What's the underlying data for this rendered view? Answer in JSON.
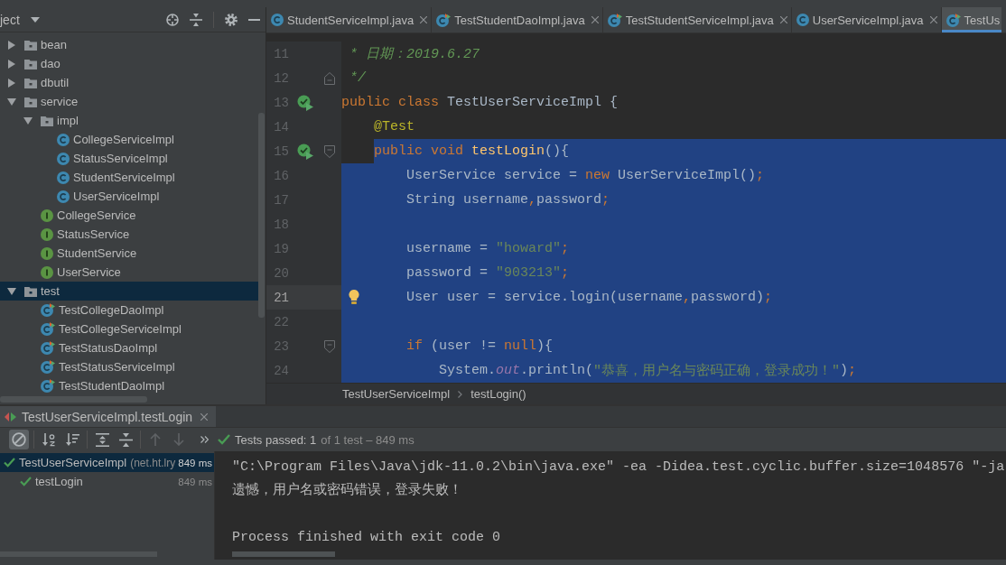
{
  "project_panel": {
    "view_label": "ject",
    "tree": [
      {
        "label": "bean",
        "kind": "package",
        "expanded": false,
        "selected": false
      },
      {
        "label": "dao",
        "kind": "package",
        "expanded": false,
        "selected": false
      },
      {
        "label": "dbutil",
        "kind": "package",
        "expanded": false,
        "selected": false
      },
      {
        "label": "service",
        "kind": "package",
        "expanded": true,
        "selected": false,
        "children": [
          {
            "label": "impl",
            "kind": "package",
            "expanded": true,
            "selected": false,
            "children": [
              {
                "label": "CollegeServiceImpl",
                "kind": "class",
                "selected": false
              },
              {
                "label": "StatusServiceImpl",
                "kind": "class",
                "selected": false
              },
              {
                "label": "StudentServiceImpl",
                "kind": "class",
                "selected": false
              },
              {
                "label": "UserServiceImpl",
                "kind": "class",
                "selected": false
              }
            ]
          },
          {
            "label": "CollegeService",
            "kind": "interface",
            "selected": false
          },
          {
            "label": "StatusService",
            "kind": "interface",
            "selected": false
          },
          {
            "label": "StudentService",
            "kind": "interface",
            "selected": false
          },
          {
            "label": "UserService",
            "kind": "interface",
            "selected": false
          }
        ]
      },
      {
        "label": "test",
        "kind": "package",
        "expanded": true,
        "selected": true,
        "children": [
          {
            "label": "TestCollegeDaoImpl",
            "kind": "test_class",
            "selected": false
          },
          {
            "label": "TestCollegeServiceImpl",
            "kind": "test_class",
            "selected": false
          },
          {
            "label": "TestStatusDaoImpl",
            "kind": "test_class",
            "selected": false
          },
          {
            "label": "TestStatusServiceImpl",
            "kind": "test_class",
            "selected": false
          },
          {
            "label": "TestStudentDaoImpl",
            "kind": "test_class",
            "selected": false
          }
        ]
      }
    ]
  },
  "editor": {
    "tabs": [
      {
        "label": "StudentServiceImpl.java",
        "kind": "class",
        "selected": false,
        "close_button": true
      },
      {
        "label": "TestStudentDaoImpl.java",
        "kind": "test_class",
        "selected": false,
        "close_button": true
      },
      {
        "label": "TestStudentServiceImpl.java",
        "kind": "test_class",
        "selected": false,
        "close_button": true
      },
      {
        "label": "UserServiceImpl.java",
        "kind": "class",
        "selected": false,
        "close_button": true
      },
      {
        "label": "TestUs",
        "kind": "test_class",
        "selected": true,
        "close_button": false
      }
    ],
    "lines": [
      {
        "number": "11",
        "selected": false,
        "caret": false,
        "tokens": [
          {
            "text": " * 日期：2019.6.27",
            "kind": "comment"
          }
        ]
      },
      {
        "number": "12",
        "selected": false,
        "caret": false,
        "gutter_marks": [
          {
            "kind": "fold_end"
          }
        ],
        "tokens": [
          {
            "text": " */",
            "kind": "comment"
          }
        ]
      },
      {
        "number": "13",
        "selected": false,
        "caret": false,
        "gutter_marks": [
          {
            "kind": "run_test"
          }
        ],
        "tokens": [
          {
            "text": "public class",
            "kind": "keyword"
          },
          {
            "text": " TestUserServiceImpl {",
            "kind": "plain"
          }
        ]
      },
      {
        "number": "14",
        "selected": false,
        "caret": false,
        "tokens": [
          {
            "text": "    @Test",
            "kind": "annotation"
          }
        ]
      },
      {
        "number": "15",
        "selected": true,
        "caret": false,
        "gutter_marks": [
          {
            "kind": "run_test"
          },
          {
            "kind": "fold_start"
          }
        ],
        "tokens": [
          {
            "text": "    public void ",
            "kind": "keyword"
          },
          {
            "text": "testLogin",
            "kind": "method"
          },
          {
            "text": "(){",
            "kind": "plain"
          }
        ]
      },
      {
        "number": "16",
        "selected": true,
        "caret": false,
        "tokens": [
          {
            "text": "        UserService service = ",
            "kind": "plain"
          },
          {
            "text": "new",
            "kind": "keyword"
          },
          {
            "text": " UserServiceImpl()",
            "kind": "plain"
          },
          {
            "text": ";",
            "kind": "keyword"
          }
        ]
      },
      {
        "number": "17",
        "selected": true,
        "caret": false,
        "tokens": [
          {
            "text": "        String username",
            "kind": "plain"
          },
          {
            "text": ",",
            "kind": "keyword"
          },
          {
            "text": "password",
            "kind": "plain"
          },
          {
            "text": ";",
            "kind": "keyword"
          }
        ]
      },
      {
        "number": "18",
        "selected": true,
        "caret": false
      },
      {
        "number": "19",
        "selected": true,
        "caret": false,
        "tokens": [
          {
            "text": "        username = ",
            "kind": "plain"
          },
          {
            "text": "\"howard\"",
            "kind": "string"
          },
          {
            "text": ";",
            "kind": "keyword"
          }
        ]
      },
      {
        "number": "20",
        "selected": true,
        "caret": false,
        "tokens": [
          {
            "text": "        password = ",
            "kind": "plain"
          },
          {
            "text": "\"903213\"",
            "kind": "string"
          },
          {
            "text": ";",
            "kind": "keyword"
          }
        ]
      },
      {
        "number": "21",
        "selected": true,
        "caret": true,
        "gutter_marks": [
          {
            "kind": "bulb"
          }
        ],
        "tokens": [
          {
            "text": "        User user = service.login(username",
            "kind": "plain"
          },
          {
            "text": ",",
            "kind": "keyword"
          },
          {
            "text": "password)",
            "kind": "plain"
          },
          {
            "text": ";",
            "kind": "keyword"
          }
        ]
      },
      {
        "number": "22",
        "selected": true,
        "caret": false
      },
      {
        "number": "23",
        "selected": true,
        "caret": false,
        "gutter_marks": [
          {
            "kind": "fold_start"
          }
        ],
        "tokens": [
          {
            "text": "        if",
            "kind": "keyword"
          },
          {
            "text": " (user != ",
            "kind": "plain"
          },
          {
            "text": "null",
            "kind": "keyword"
          },
          {
            "text": "){",
            "kind": "plain"
          }
        ]
      },
      {
        "number": "24",
        "selected": true,
        "caret": false,
        "tokens": [
          {
            "text": "            System.",
            "kind": "plain"
          },
          {
            "text": "out",
            "kind": "field"
          },
          {
            "text": ".println(",
            "kind": "plain"
          },
          {
            "text": "\"恭喜，用户名与密码正确，登录成功！\"",
            "kind": "string"
          },
          {
            "text": ")",
            "kind": "plain"
          },
          {
            "text": ";",
            "kind": "keyword"
          }
        ]
      }
    ],
    "breadcrumbs": [
      "TestUserServiceImpl",
      "testLogin()"
    ]
  },
  "run_panel": {
    "tab": {
      "label": "TestUserServiceImpl.testLogin",
      "selected": true
    },
    "toolbar": [
      {
        "kind": "toggle_passed",
        "on": true,
        "disabled": false
      },
      {
        "kind": "sort_alpha",
        "on": false,
        "disabled": false
      },
      {
        "kind": "sort_duration",
        "on": false,
        "disabled": false
      },
      {
        "kind": "expand_all",
        "on": false,
        "disabled": false
      },
      {
        "kind": "collapse_all",
        "on": false,
        "disabled": false
      },
      {
        "kind": "previous",
        "on": false,
        "disabled": true
      },
      {
        "kind": "next",
        "on": false,
        "disabled": true
      },
      {
        "kind": "more",
        "on": false,
        "disabled": false
      }
    ],
    "status": {
      "passed": true,
      "summary": "Tests passed: 1",
      "detail": "of 1 test – 849 ms"
    },
    "results": [
      {
        "name": "TestUserServiceImpl",
        "package": "(net.ht.lry",
        "time": "849 ms",
        "passed": true,
        "selected": true,
        "children": [
          {
            "name": "testLogin",
            "time": "849 ms",
            "passed": true,
            "selected": false
          }
        ]
      }
    ],
    "console": [
      {
        "kind": "output",
        "text": "\"C:\\Program Files\\Java\\jdk-11.0.2\\bin\\java.exe\" -ea -Didea.test.cyclic.buffer.size=1048576 \"-ja"
      },
      {
        "kind": "output",
        "text": "遗憾，用户名或密码错误，登录失败！"
      },
      {
        "kind": "blank"
      },
      {
        "kind": "output",
        "text": "Process finished with exit code 0"
      }
    ]
  }
}
